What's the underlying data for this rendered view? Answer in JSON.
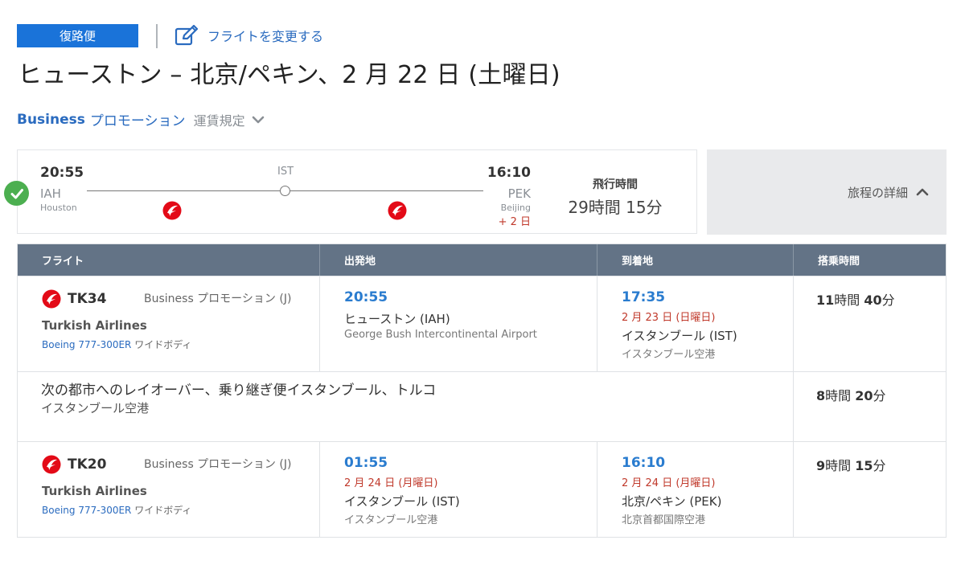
{
  "header": {
    "badge": "復路便",
    "change_link": "フライトを変更する",
    "title": "ヒューストン – 北京/ペキン、2 月 22 日 (土曜日)"
  },
  "fare": {
    "class": "Business",
    "promo": "プロモーション",
    "rules_link": "運賃規定"
  },
  "summary": {
    "departure": {
      "time": "20:55",
      "code": "IAH",
      "city": "Houston"
    },
    "stop": {
      "code": "IST"
    },
    "arrival": {
      "time": "16:10",
      "code": "PEK",
      "city": "Beijing",
      "day_offset": "+ 2 日"
    },
    "duration_label": "飛行時間",
    "duration_value": "29時間 15分",
    "details_label": "旅程の詳細"
  },
  "table": {
    "headers": [
      "フライト",
      "出発地",
      "到着地",
      "搭乗時間"
    ],
    "segments": [
      {
        "flight_no": "TK34",
        "cabin": "Business プロモーション (J)",
        "airline": "Turkish Airlines",
        "aircraft_model": "Boeing 777-300ER",
        "aircraft_type": "ワイドボディ",
        "dep": {
          "time": "20:55",
          "date": "",
          "city": "ヒューストン (IAH)",
          "airport": "George Bush Intercontinental Airport"
        },
        "arr": {
          "time": "17:35",
          "date": "2 月 23 日 (日曜日)",
          "city": "イスタンブール (IST)",
          "airport": "イスタンブール空港"
        },
        "duration": {
          "h": "11",
          "h_unit": "時間",
          "m": "40",
          "m_unit": "分"
        }
      },
      {
        "flight_no": "TK20",
        "cabin": "Business プロモーション (J)",
        "airline": "Turkish Airlines",
        "aircraft_model": "Boeing 777-300ER",
        "aircraft_type": "ワイドボディ",
        "dep": {
          "time": "01:55",
          "date": "2 月 24 日 (月曜日)",
          "city": "イスタンブール (IST)",
          "airport": "イスタンブール空港"
        },
        "arr": {
          "time": "16:10",
          "date": "2 月 24 日 (月曜日)",
          "city": "北京/ペキン (PEK)",
          "airport": "北京首都国際空港"
        },
        "duration": {
          "h": "9",
          "h_unit": "時間",
          "m": "15",
          "m_unit": "分"
        }
      }
    ],
    "layover": {
      "text": "次の都市へのレイオーバー、乗り継ぎ便イスタンブール、トルコ",
      "airport": "イスタンブール空港",
      "duration": {
        "h": "8",
        "h_unit": "時間",
        "m": "20",
        "m_unit": "分"
      }
    }
  },
  "colors": {
    "badge": "#1a73d9",
    "link": "#2a6bbf",
    "table_header": "#637386",
    "time_blue": "#2a7ccf",
    "date_red": "#c0392b",
    "check_green": "#4caf50",
    "airline_red": "#e30a17"
  }
}
